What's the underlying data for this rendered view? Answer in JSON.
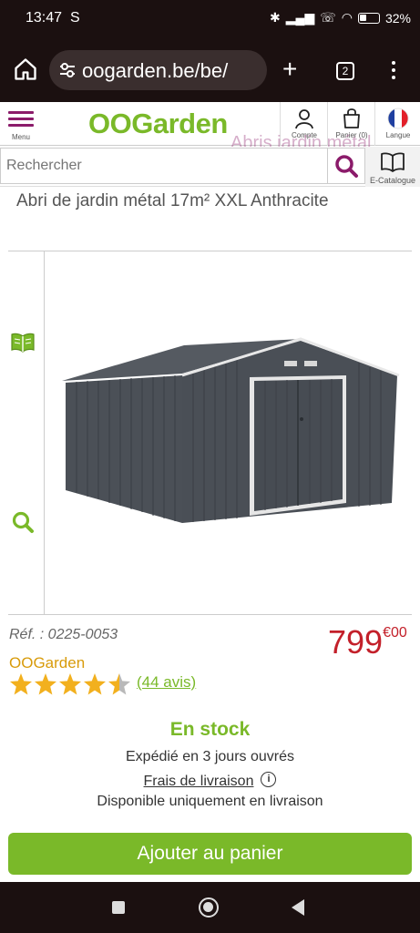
{
  "status": {
    "time": "13:47",
    "carrier": "S",
    "battery": "32%"
  },
  "browser": {
    "url": "oogarden.be/be/",
    "tab_count": "2"
  },
  "header": {
    "menu_label": "Menu",
    "logo": "OOGarden",
    "account_label": "Compte",
    "cart_label": "Panier (0)",
    "language_label": "Langue",
    "ghost_title": "Abris jardin métal"
  },
  "search": {
    "placeholder": "Rechercher",
    "ecatalogue_label": "E-Catalogue"
  },
  "product": {
    "title": "Abri de jardin métal 17m² XXL Anthracite",
    "ref": "Réf. : 0225-0053",
    "price_main": "799",
    "price_cents": "€00",
    "brand": "OOGarden",
    "rating": 4.5,
    "rating_max": 5,
    "reviews": "(44 avis)",
    "stock": "En stock",
    "shipped": "Expédié en 3 jours ouvrés",
    "delivery_link": "Frais de livraison",
    "availability": "Disponible uniquement en livraison",
    "add_to_cart": "Ajouter au panier"
  },
  "colors": {
    "brand_green": "#7ab929",
    "accent_purple": "#8b1b6a",
    "price_red": "#c3202a",
    "star_gold": "#f2b01e"
  }
}
